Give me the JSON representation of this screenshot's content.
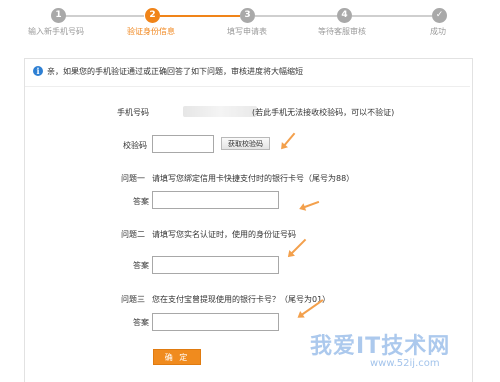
{
  "steps": [
    {
      "num": "1",
      "label": "输入新手机号码"
    },
    {
      "num": "2",
      "label": "验证身份信息"
    },
    {
      "num": "3",
      "label": "填写申请表"
    },
    {
      "num": "4",
      "label": "等待客服审核"
    },
    {
      "num": "✓",
      "label": "成功"
    }
  ],
  "notice": {
    "icon": "i",
    "text": "亲，如果您的手机验证通过或正确回答了如下问题，审核进度将大幅缩短"
  },
  "phone": {
    "label": "手机号码",
    "note": "(若此手机无法接收校验码，可以不验证)"
  },
  "code": {
    "label": "校验码",
    "value": "",
    "button": "获取校验码"
  },
  "questions": [
    {
      "title": "问题一",
      "text": "请填写您绑定信用卡快捷支付时的银行卡号（尾号为88）",
      "answer_label": "答案",
      "value": ""
    },
    {
      "title": "问题二",
      "text": "请填写您实名认证时，使用的身份证号码",
      "answer_label": "答案",
      "value": ""
    },
    {
      "title": "问题三",
      "text": "您在支付宝曾提现使用的银行卡号？（尾号为01）",
      "answer_label": "答案",
      "value": ""
    }
  ],
  "confirm_button": "确 定",
  "watermark": {
    "main": "我爱IT技术网",
    "sub": "www.52ij.com"
  },
  "colors": {
    "accent": "#f08419",
    "inactive": "#a9a9a9",
    "info": "#2d7fd3"
  }
}
